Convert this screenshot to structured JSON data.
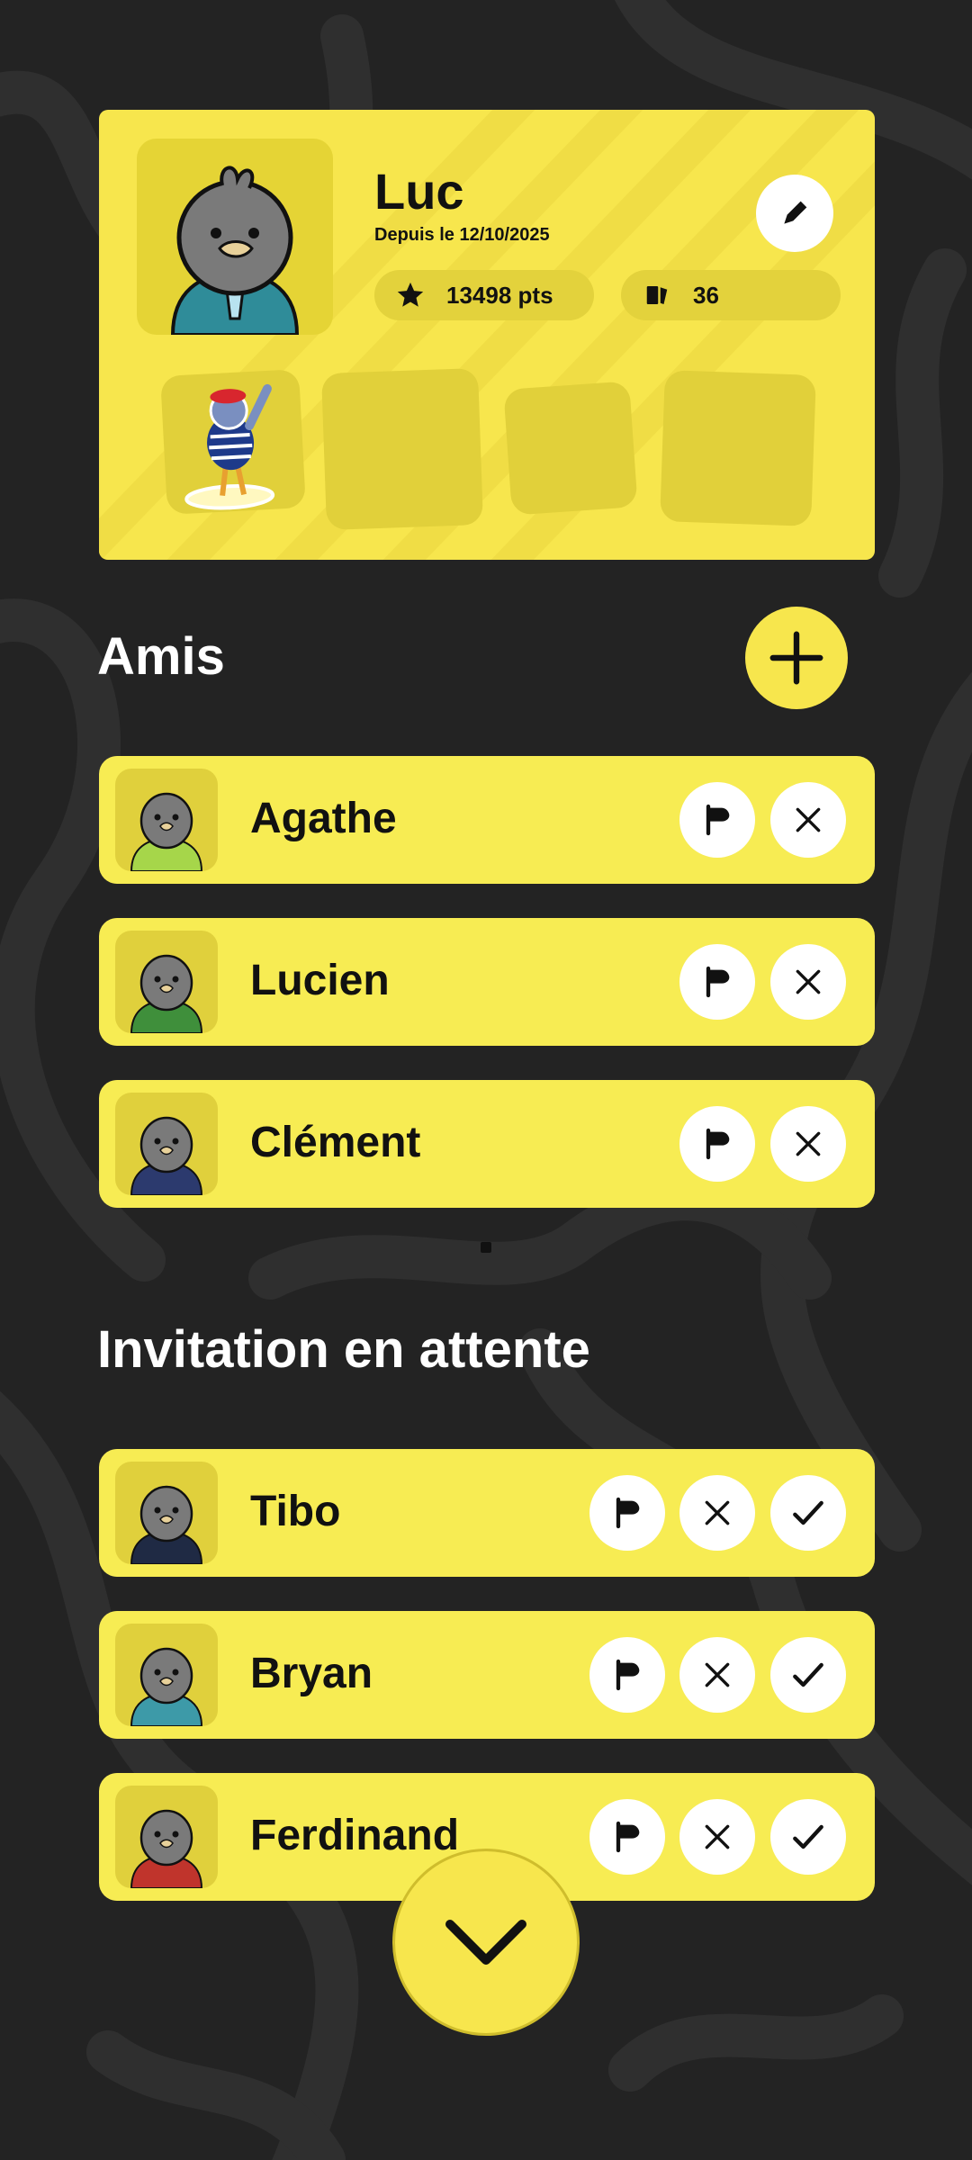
{
  "profile": {
    "name": "Luc",
    "since": "Depuis le 12/10/2025",
    "points": "13498 pts",
    "cards": "36"
  },
  "sections": {
    "friends_title": "Amis",
    "pending_title": "Invitation en attente"
  },
  "friends": [
    {
      "name": "Agathe",
      "avatar_color": "#a6d64a"
    },
    {
      "name": "Lucien",
      "avatar_color": "#3f8f3b"
    },
    {
      "name": "Clément",
      "avatar_color": "#2c3a6e"
    }
  ],
  "pending": [
    {
      "name": "Tibo",
      "avatar_color": "#1f2a44"
    },
    {
      "name": "Bryan",
      "avatar_color": "#3d9aa8"
    },
    {
      "name": "Ferdinand",
      "avatar_color": "#c0342c"
    }
  ],
  "colors": {
    "accent": "#f7e64d",
    "background": "#232323",
    "row": "#f7ec53"
  },
  "icons": {
    "star": "star-icon",
    "cards": "cards-icon",
    "edit": "pencil-icon",
    "add": "plus-icon",
    "report": "flag-icon",
    "remove": "close-icon",
    "accept": "check-icon",
    "scroll": "chevron-down-icon"
  }
}
